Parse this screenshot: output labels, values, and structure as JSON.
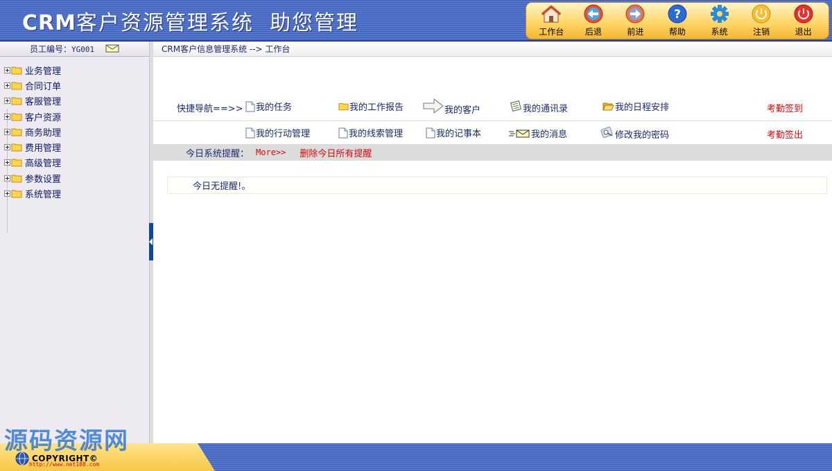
{
  "header": {
    "title_latin": "CRM",
    "title_cn": "客户资源管理系统",
    "subtitle": "助您管理",
    "toolbar": [
      {
        "label": "工作台",
        "icon": "home-icon"
      },
      {
        "label": "后退",
        "icon": "back-arrow-icon"
      },
      {
        "label": "前进",
        "icon": "forward-arrow-icon"
      },
      {
        "label": "帮助",
        "icon": "help-icon"
      },
      {
        "label": "系统",
        "icon": "gear-icon"
      },
      {
        "label": "注销",
        "icon": "logout-power-icon"
      },
      {
        "label": "退出",
        "icon": "exit-power-icon"
      }
    ]
  },
  "sidebar": {
    "employee_label": "员工编号：",
    "employee_id": "YG001",
    "tree": [
      {
        "label": "业务管理"
      },
      {
        "label": "合同订单"
      },
      {
        "label": "客服管理"
      },
      {
        "label": "客户资源"
      },
      {
        "label": "商务助理"
      },
      {
        "label": "费用管理"
      },
      {
        "label": "高级管理"
      },
      {
        "label": "参数设置"
      },
      {
        "label": "系统管理"
      }
    ]
  },
  "breadcrumb": "CRM客户信息管理系统 --> 工作台",
  "quicknav": {
    "title": "快捷导航==>>",
    "row1": [
      {
        "label": "我的任务",
        "icon": "document-icon"
      },
      {
        "label": "我的工作报告",
        "icon": "folder-icon"
      },
      {
        "label": "我的客户",
        "icon": "arrow-right-icon"
      },
      {
        "label": "我的通讯录",
        "icon": "notebook-icon"
      },
      {
        "label": "我的日程安排",
        "icon": "open-folder-icon"
      }
    ],
    "row2": [
      {
        "label": "我的行动管理",
        "icon": "document-icon"
      },
      {
        "label": "我的线索管理",
        "icon": "document-icon"
      },
      {
        "label": "我的记事本",
        "icon": "document-icon"
      },
      {
        "label": "我的消息",
        "icon": "envelope-icon"
      },
      {
        "label": "修改我的密码",
        "icon": "key-icon"
      }
    ],
    "checkin": "考勤签到",
    "checkout": "考勤签出"
  },
  "reminders": {
    "title": "今日系统提醒：",
    "more": "More>>",
    "delete_all": "删除今日所有提醒",
    "empty_text": "今日无提醒!。"
  },
  "watermark": "源码资源网",
  "footer": {
    "copyright": "COPYRIGHT©",
    "url": "http://www.net188.com"
  },
  "colors": {
    "header_blue": "#4a6bc0",
    "toolbar_gold": "#ffd769",
    "sidebar_bg": "#edeaf2",
    "link_red": "#d8070c",
    "text_navy": "#1a2a6c"
  }
}
